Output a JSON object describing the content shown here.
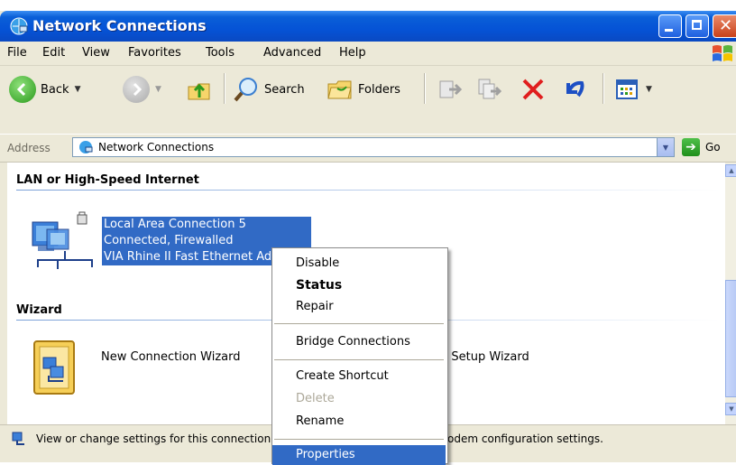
{
  "window": {
    "title": "Network Connections"
  },
  "menubar": {
    "items": [
      "File",
      "Edit",
      "View",
      "Favorites",
      "Tools",
      "Advanced",
      "Help"
    ]
  },
  "toolbar": {
    "back_label": "Back",
    "search_label": "Search",
    "folders_label": "Folders"
  },
  "address": {
    "label": "Address",
    "value": "Network Connections",
    "go_label": "Go"
  },
  "content": {
    "lan_group": "LAN or High-Speed Internet",
    "connection": {
      "name": "Local Area Connection 5",
      "status": "Connected, Firewalled",
      "device": "VIA Rhine II Fast Ethernet Adapter"
    },
    "wizard_group": "Wizard",
    "wizards": [
      "New Connection Wizard",
      "Network Setup Wizard"
    ]
  },
  "statusbar": {
    "text": "View or change settings for this connection, such as adapter, protocol, or modem configuration settings."
  },
  "context_menu": {
    "disable": "Disable",
    "status": "Status",
    "repair": "Repair",
    "bridge": "Bridge Connections",
    "shortcut": "Create Shortcut",
    "delete": "Delete",
    "rename": "Rename",
    "properties": "Properties"
  },
  "colors": {
    "titlebar": "#0553d6",
    "selection": "#316ac5",
    "chrome": "#ece9d8"
  }
}
